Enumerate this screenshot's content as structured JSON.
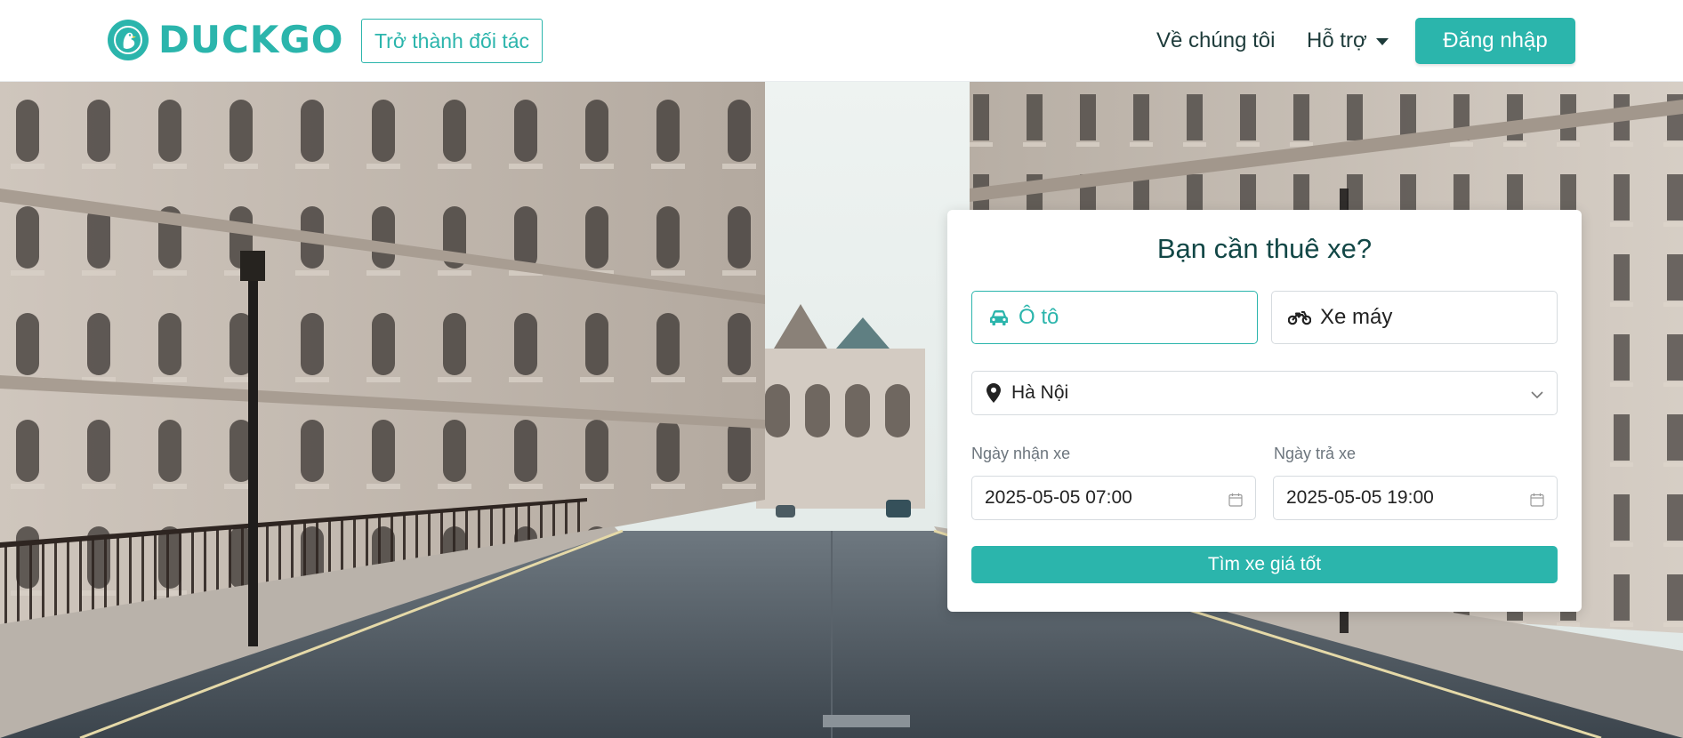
{
  "header": {
    "logo_text": "DUCKGO",
    "partner_label": "Trở thành đối tác",
    "nav_about": "Về chúng tôi",
    "nav_support": "Hỗ trợ",
    "login_label": "Đăng nhập"
  },
  "booking": {
    "title": "Bạn cần thuê xe?",
    "tabs": [
      {
        "label": "Ô tô",
        "icon": "car-icon",
        "active": true
      },
      {
        "label": "Xe máy",
        "icon": "motorbike-icon",
        "active": false
      }
    ],
    "location": {
      "value": "Hà Nội",
      "icon": "map-pin-icon"
    },
    "pickup": {
      "label": "Ngày nhận xe",
      "value": "2025-05-05 07:00"
    },
    "return": {
      "label": "Ngày trả xe",
      "value": "2025-05-05 19:00"
    },
    "search_label": "Tìm xe giá tốt"
  },
  "hero_image": "city-street-background",
  "colors": {
    "brand": "#2bb5ac",
    "title_text": "#124746",
    "nav_text": "#1d3b3a"
  }
}
